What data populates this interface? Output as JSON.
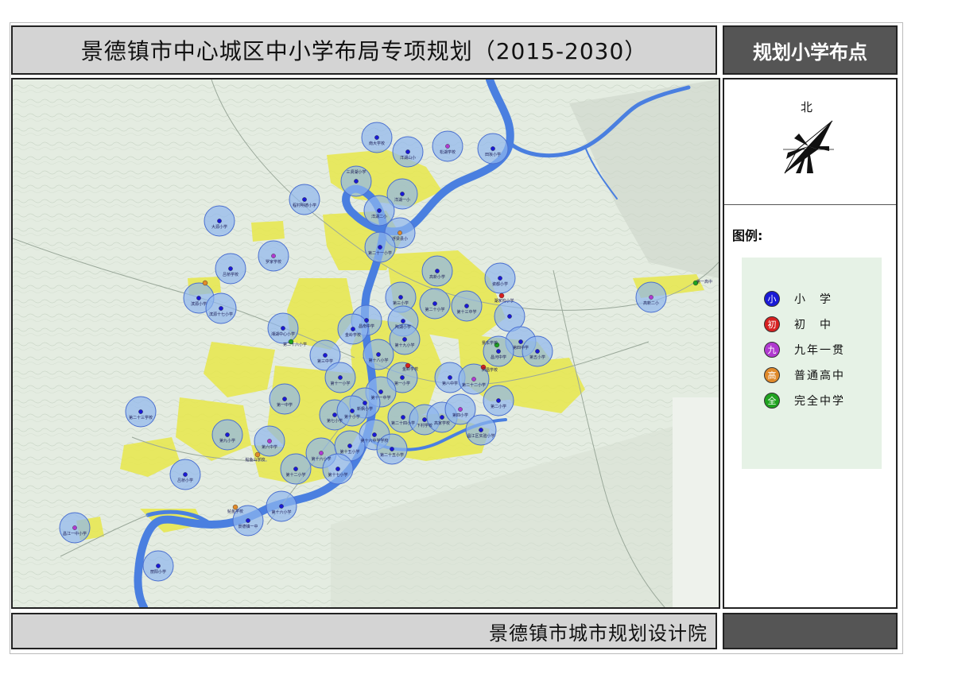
{
  "title": "景德镇市中心城区中小学布局专项规划（2015-2030）",
  "side_title": "规划小学布点",
  "north_label": "北",
  "legend": {
    "heading": "图例:",
    "items": [
      {
        "symbol": "小",
        "label": "小　学",
        "color": "#1a1ad6"
      },
      {
        "symbol": "初",
        "label": "初　中",
        "color": "#d62020"
      },
      {
        "symbol": "九",
        "label": "九年一贯",
        "color": "#b03ad0"
      },
      {
        "symbol": "高",
        "label": "普通高中",
        "color": "#e08a2a"
      },
      {
        "symbol": "全",
        "label": "完全中学",
        "color": "#1fa31f"
      }
    ]
  },
  "footer": "景德镇市城市规划设计院",
  "colors": {
    "water": "#4a7fe0",
    "urban": "#e8e84a",
    "terrain": "#e3ebe0",
    "service_radius": "#8fb6ee"
  },
  "school_labels": [
    {
      "type": "小",
      "text": "南大学校"
    },
    {
      "type": "小",
      "text": "洋湖山小"
    },
    {
      "type": "九",
      "text": "松湖学校"
    },
    {
      "type": "小",
      "text": "田坂小学"
    },
    {
      "type": "小",
      "text": "三贤湖小学"
    },
    {
      "type": "小",
      "text": "洋湖一小"
    },
    {
      "type": "小",
      "text": "程村明德小学"
    },
    {
      "type": "小",
      "text": "洋湖二小"
    },
    {
      "type": "小",
      "text": "大源小学"
    },
    {
      "type": "高",
      "text": "浮梁县小"
    },
    {
      "type": "小",
      "text": "第二十一小学"
    },
    {
      "type": "九",
      "text": "罗家学校"
    },
    {
      "type": "小",
      "text": "高新小学"
    },
    {
      "type": "小",
      "text": "瓷都小学"
    },
    {
      "type": "小",
      "text": "吕桥学校"
    },
    {
      "type": "小",
      "text": "滨源小学"
    },
    {
      "type": "小",
      "text": "滨源十七小学"
    },
    {
      "type": "小",
      "text": "第三小学"
    },
    {
      "type": "小",
      "text": "第二十小学"
    },
    {
      "type": "小",
      "text": "陶湖小学"
    },
    {
      "type": "初",
      "text": "第十三中学"
    },
    {
      "type": "小",
      "text": "湖家坞小学"
    },
    {
      "type": "小",
      "text": "高新二小"
    },
    {
      "type": "九",
      "text": "湘湖中心小学"
    },
    {
      "type": "全",
      "text": "昌南中学"
    },
    {
      "type": "小",
      "text": "金岭学校"
    },
    {
      "type": "小",
      "text": "第十九小学"
    },
    {
      "type": "小",
      "text": "第三中学"
    },
    {
      "type": "小",
      "text": "第十八小学"
    },
    {
      "type": "全",
      "text": "第四中学"
    },
    {
      "type": "小",
      "text": "第五小学"
    },
    {
      "type": "全",
      "text": "昌河中学"
    },
    {
      "type": "小",
      "text": "第十一小学"
    },
    {
      "type": "小",
      "text": "第一小学"
    },
    {
      "type": "小",
      "text": "第八中学"
    },
    {
      "type": "小",
      "text": "第二十二小学"
    },
    {
      "type": "初",
      "text": "第十一中学"
    },
    {
      "type": "小",
      "text": "新枫小学"
    },
    {
      "type": "初",
      "text": "第一中学"
    },
    {
      "type": "小",
      "text": "第二小学"
    },
    {
      "type": "九",
      "text": "第二十三学校"
    },
    {
      "type": "小",
      "text": "第七小学"
    },
    {
      "type": "小",
      "text": "第十小学"
    },
    {
      "type": "小",
      "text": "第二十四小学"
    },
    {
      "type": "小",
      "text": "下村学校"
    },
    {
      "type": "小",
      "text": "高家学校"
    },
    {
      "type": "小",
      "text": "第四小学"
    },
    {
      "type": "小",
      "text": "第九小学"
    },
    {
      "type": "小",
      "text": "第六中学"
    },
    {
      "type": "小",
      "text": "第十六中学学校"
    },
    {
      "type": "小",
      "text": "第十六小学"
    },
    {
      "type": "小",
      "text": "第十五小学"
    },
    {
      "type": "小",
      "text": "第二十五小学"
    },
    {
      "type": "九",
      "text": "昌江区实验小学"
    },
    {
      "type": "小",
      "text": "第十二小学"
    },
    {
      "type": "小",
      "text": "第十七小学"
    },
    {
      "type": "小",
      "text": "吕桥小学"
    },
    {
      "type": "小",
      "text": "第十六小学"
    },
    {
      "type": "高",
      "text": "景德镇一中"
    },
    {
      "type": "小",
      "text": "昌江一中小学"
    },
    {
      "type": "小",
      "text": "丽阳小学"
    },
    {
      "type": "小",
      "text": "鲇鱼山学校"
    },
    {
      "type": "小",
      "text": "鲇鱼学校"
    },
    {
      "type": "高",
      "text": "第一高中"
    },
    {
      "type": "小",
      "text": "第二十六小学"
    },
    {
      "type": "小",
      "text": "景东学校"
    },
    {
      "type": "九",
      "text": "金岭学校"
    },
    {
      "type": "小",
      "text": "凤凰学校"
    }
  ]
}
